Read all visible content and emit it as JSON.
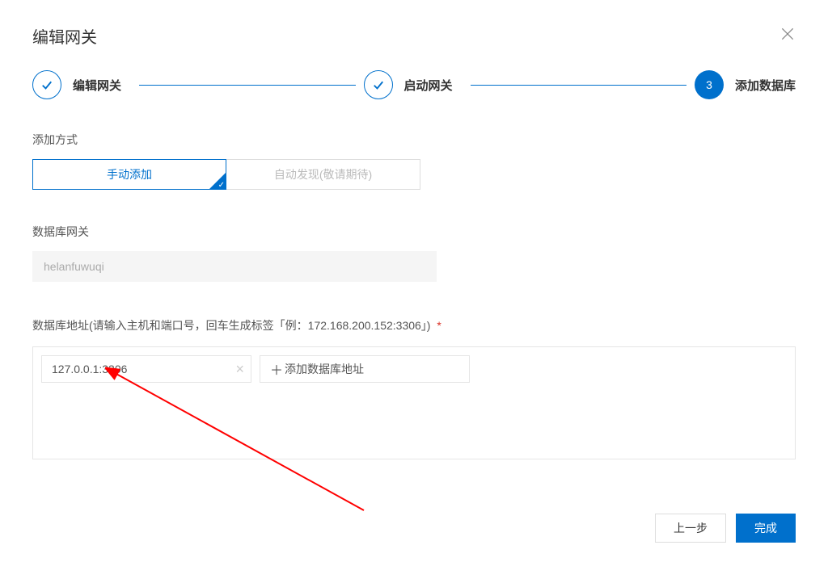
{
  "dialog": {
    "title": "编辑网关"
  },
  "stepper": {
    "step1": {
      "label": "编辑网关"
    },
    "step2": {
      "label": "启动网关"
    },
    "step3": {
      "number": "3",
      "label": "添加数据库"
    }
  },
  "add_mode": {
    "section_label": "添加方式",
    "manual": "手动添加",
    "auto": "自动发现(敬请期待)"
  },
  "gateway": {
    "section_label": "数据库网关",
    "value": "helanfuwuqi"
  },
  "db_address": {
    "label": "数据库地址(请输入主机和端口号，回车生成标签「例：172.168.200.152:3306」)",
    "required_mark": "*",
    "tag_value": "127.0.0.1:3306",
    "input_placeholder": "添加数据库地址"
  },
  "footer": {
    "prev": "上一步",
    "finish": "完成"
  }
}
